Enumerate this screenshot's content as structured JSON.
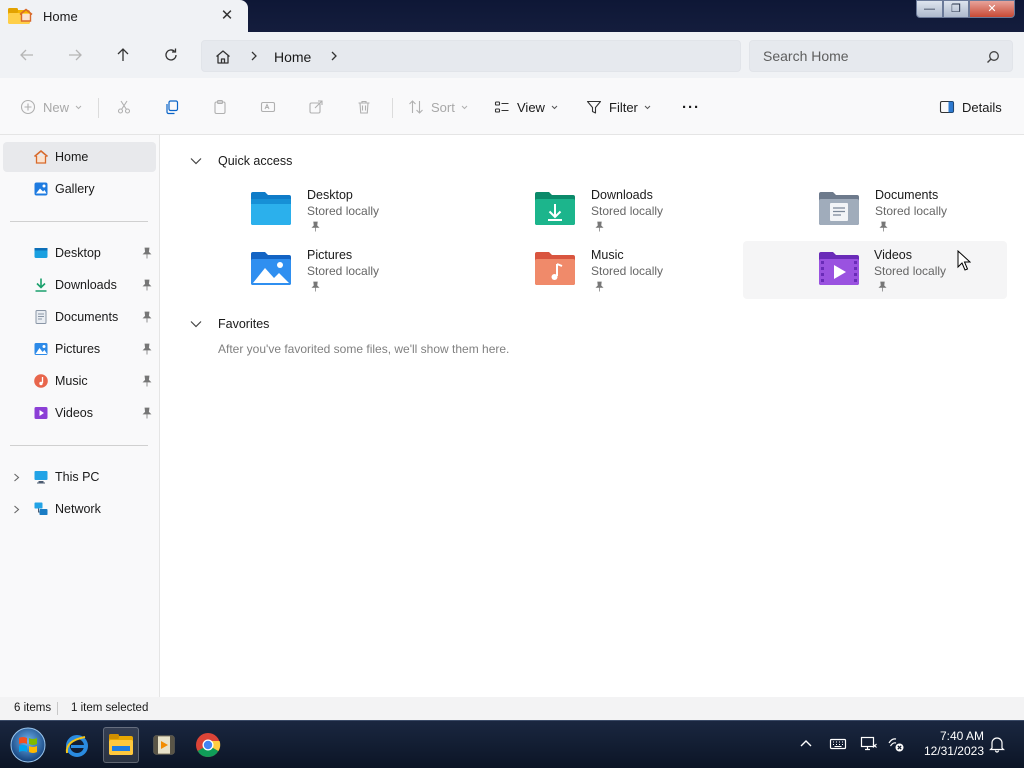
{
  "window": {
    "tab_title": "Home",
    "tab_close": "✕",
    "controls": {
      "minimize": "—",
      "maximize": "❐",
      "close": "✕"
    }
  },
  "address": {
    "crumb": "Home",
    "search_placeholder": "Search Home"
  },
  "toolbar": {
    "new_label": "New",
    "sort_label": "Sort",
    "view_label": "View",
    "filter_label": "Filter",
    "more_label": "···",
    "details_label": "Details"
  },
  "sidebar": {
    "top": [
      {
        "label": "Home"
      },
      {
        "label": "Gallery"
      }
    ],
    "pinned": [
      {
        "label": "Desktop"
      },
      {
        "label": "Downloads"
      },
      {
        "label": "Documents"
      },
      {
        "label": "Pictures"
      },
      {
        "label": "Music"
      },
      {
        "label": "Videos"
      }
    ],
    "locations": [
      {
        "label": "This PC"
      },
      {
        "label": "Network"
      }
    ]
  },
  "quick_access": {
    "heading": "Quick access",
    "items": [
      {
        "name": "Desktop",
        "status": "Stored locally",
        "icon": "desktop-folder-icon"
      },
      {
        "name": "Downloads",
        "status": "Stored locally",
        "icon": "downloads-folder-icon"
      },
      {
        "name": "Documents",
        "status": "Stored locally",
        "icon": "documents-folder-icon"
      },
      {
        "name": "Pictures",
        "status": "Stored locally",
        "icon": "pictures-folder-icon"
      },
      {
        "name": "Music",
        "status": "Stored locally",
        "icon": "music-folder-icon"
      },
      {
        "name": "Videos",
        "status": "Stored locally",
        "icon": "videos-folder-icon"
      }
    ]
  },
  "favorites": {
    "heading": "Favorites",
    "empty_message": "After you've favorited some files, we'll show them here."
  },
  "status": {
    "item_count": "6 items",
    "selection": "1 item selected"
  },
  "taskbar": {
    "time": "7:40 AM",
    "date": "12/31/2023"
  },
  "colors": {
    "accent": "#0a64c8",
    "selected_bg": "#e8e9ec",
    "title_bar": "#0e1736"
  }
}
